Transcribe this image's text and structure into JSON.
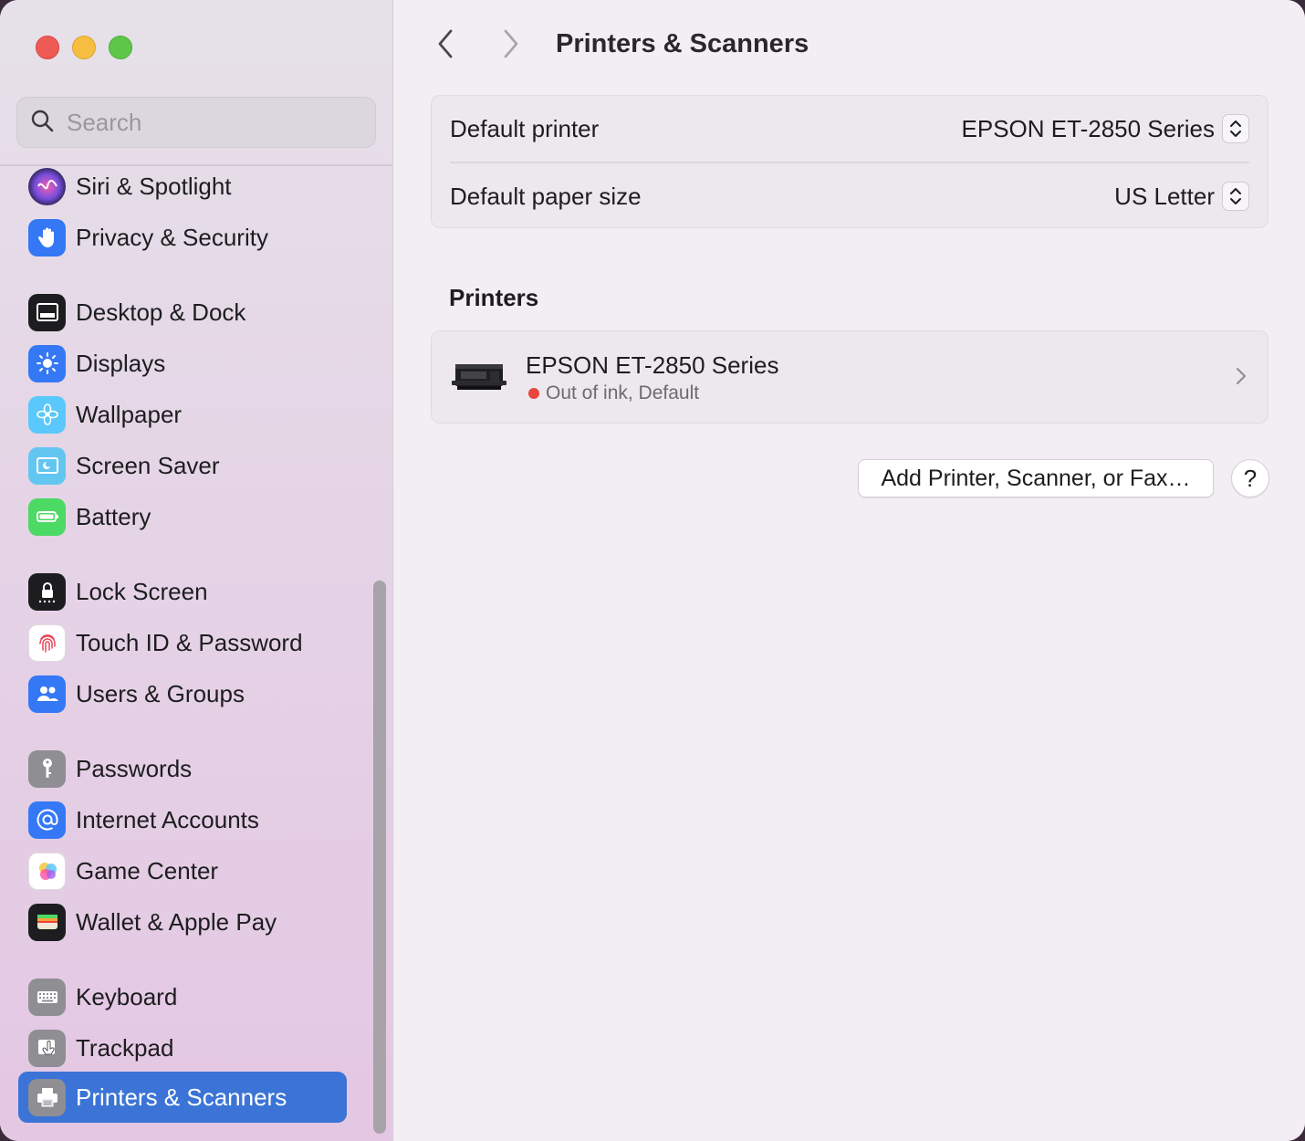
{
  "window": {
    "controls": [
      "close",
      "minimize",
      "maximize"
    ]
  },
  "search": {
    "placeholder": "Search",
    "icon": "magnifying-glass-icon"
  },
  "sidebar": {
    "items": [
      {
        "label": "Siri & Spotlight",
        "icon": "siri-icon",
        "color": "#6b3fa0"
      },
      {
        "label": "Privacy & Security",
        "icon": "hand-icon",
        "color": "#3478f6"
      },
      {
        "label": "Desktop & Dock",
        "icon": "dock-icon",
        "color": "#1d1d1f"
      },
      {
        "label": "Displays",
        "icon": "sun-icon",
        "color": "#3478f6"
      },
      {
        "label": "Wallpaper",
        "icon": "flower-icon",
        "color": "#5ac8fa"
      },
      {
        "label": "Screen Saver",
        "icon": "screen-saver-icon",
        "color": "#63c6f1"
      },
      {
        "label": "Battery",
        "icon": "battery-icon",
        "color": "#4cd964"
      },
      {
        "label": "Lock Screen",
        "icon": "lock-icon",
        "color": "#1d1d1f"
      },
      {
        "label": "Touch ID & Password",
        "icon": "fingerprint-icon",
        "color": "#ffffff"
      },
      {
        "label": "Users & Groups",
        "icon": "users-icon",
        "color": "#3478f6"
      },
      {
        "label": "Passwords",
        "icon": "key-icon",
        "color": "#8e8e93"
      },
      {
        "label": "Internet Accounts",
        "icon": "at-icon",
        "color": "#3478f6"
      },
      {
        "label": "Game Center",
        "icon": "game-center-icon",
        "color": "#ffffff"
      },
      {
        "label": "Wallet & Apple Pay",
        "icon": "wallet-icon",
        "color": "#1d1d1f"
      },
      {
        "label": "Keyboard",
        "icon": "keyboard-icon",
        "color": "#8e8e93"
      },
      {
        "label": "Trackpad",
        "icon": "trackpad-icon",
        "color": "#8e8e93"
      },
      {
        "label": "Printers & Scanners",
        "icon": "printer-icon",
        "color": "#8e8e93",
        "selected": true
      }
    ]
  },
  "header": {
    "title": "Printers & Scanners",
    "back_icon": "chevron-left-icon",
    "forward_icon": "chevron-right-icon"
  },
  "defaults": {
    "printer_label": "Default printer",
    "printer_value": "EPSON ET-2850 Series",
    "paper_label": "Default paper size",
    "paper_value": "US Letter"
  },
  "printers": {
    "section_title": "Printers",
    "items": [
      {
        "name": "EPSON ET-2850 Series",
        "status": "Out of ink, Default",
        "status_color": "#e8453c"
      }
    ]
  },
  "actions": {
    "add_label": "Add Printer, Scanner, or Fax…",
    "help_label": "?"
  },
  "colors": {
    "accent": "#3b74d6",
    "sidebar_bg": "#e5d4e6",
    "content_bg": "#f2eef3"
  }
}
